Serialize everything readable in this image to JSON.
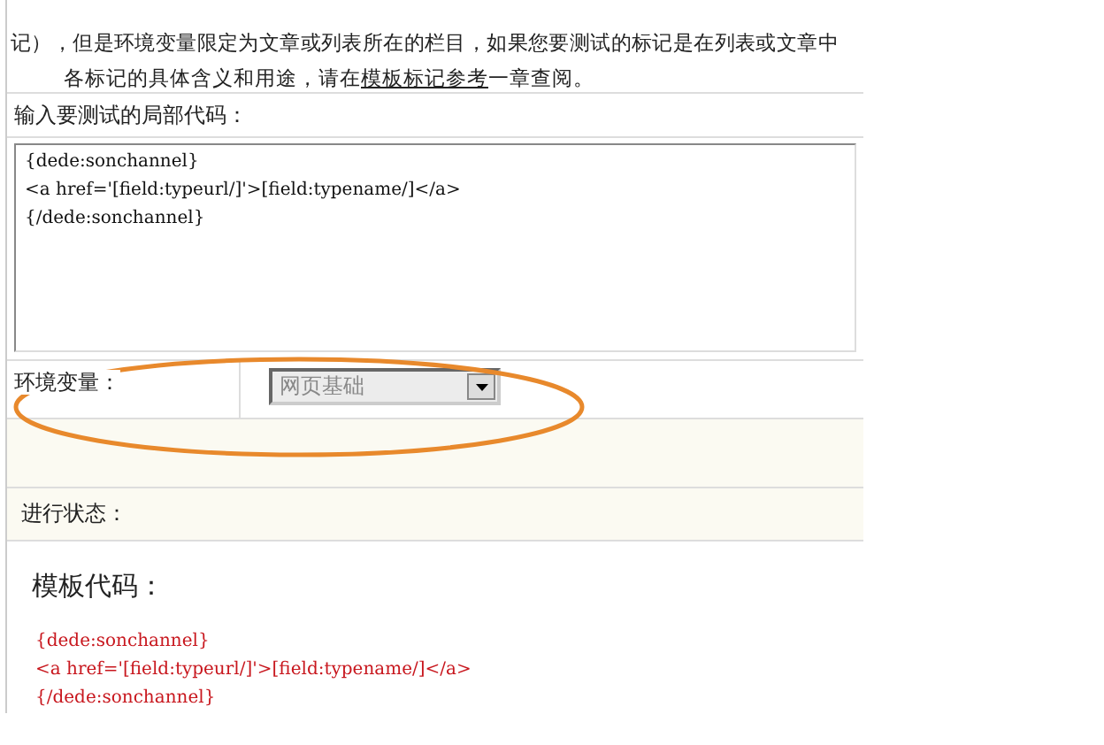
{
  "intro": {
    "line_1": "记），但是环境变量限定为文章或列表所在的栏目，如果您要测试的标记是在列表或文章中",
    "line_2_before": "各标记的具体含义和用途，请在",
    "line_2_link": "模板标记参考",
    "line_2_after": "一章查阅。"
  },
  "code_input": {
    "label": "输入要测试的局部代码：",
    "value": "{dede:sonchannel}\n<a href='[field:typeurl/]'>[field:typename/]</a>\n{/dede:sonchannel}"
  },
  "environment": {
    "label": "环境变量：",
    "value": "网页基础"
  },
  "status": {
    "label": "进行状态："
  },
  "template_code": {
    "title": "模板代码：",
    "lines": [
      "{dede:sonchannel}",
      "<a href='[field:typeurl/]'>[field:typename/]</a>",
      "{/dede:sonchannel}"
    ]
  }
}
